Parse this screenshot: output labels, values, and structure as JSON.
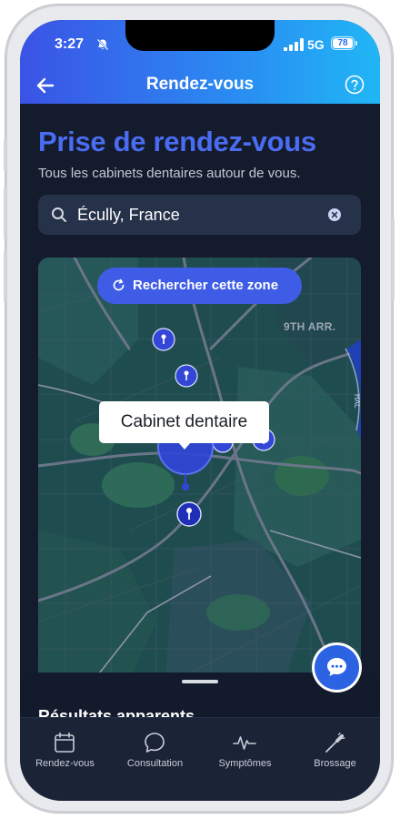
{
  "status_bar": {
    "time": "3:27",
    "network": "5G",
    "battery": "78"
  },
  "nav": {
    "title": "Rendez-vous",
    "back_icon": "arrow-left-icon",
    "help_icon": "question-circle-icon"
  },
  "page": {
    "title": "Prise de rendez-vous",
    "subtitle": "Tous les cabinets dentaires autour de vous."
  },
  "search": {
    "value": "Écully, France",
    "icon": "search-icon",
    "clear_icon": "clear-circle-icon"
  },
  "map": {
    "search_zone_label": "Rechercher cette zone",
    "district_label": "9TH ARR.",
    "tooltip": "Cabinet dentaire",
    "colors": {
      "base": "#1f4d4f",
      "road": "#5a6478",
      "accent": "#3f5ce6",
      "pin": "#3346d6"
    }
  },
  "results": {
    "title": "Résultats apparents"
  },
  "tabbar": {
    "items": [
      {
        "label": "Rendez-vous",
        "icon": "calendar-icon"
      },
      {
        "label": "Consultation",
        "icon": "chat-bubble-icon"
      },
      {
        "label": "Symptômes",
        "icon": "pulse-icon"
      },
      {
        "label": "Brossage",
        "icon": "toothbrush-icon"
      }
    ]
  },
  "chat_fab": {
    "icon": "chat-icon"
  }
}
